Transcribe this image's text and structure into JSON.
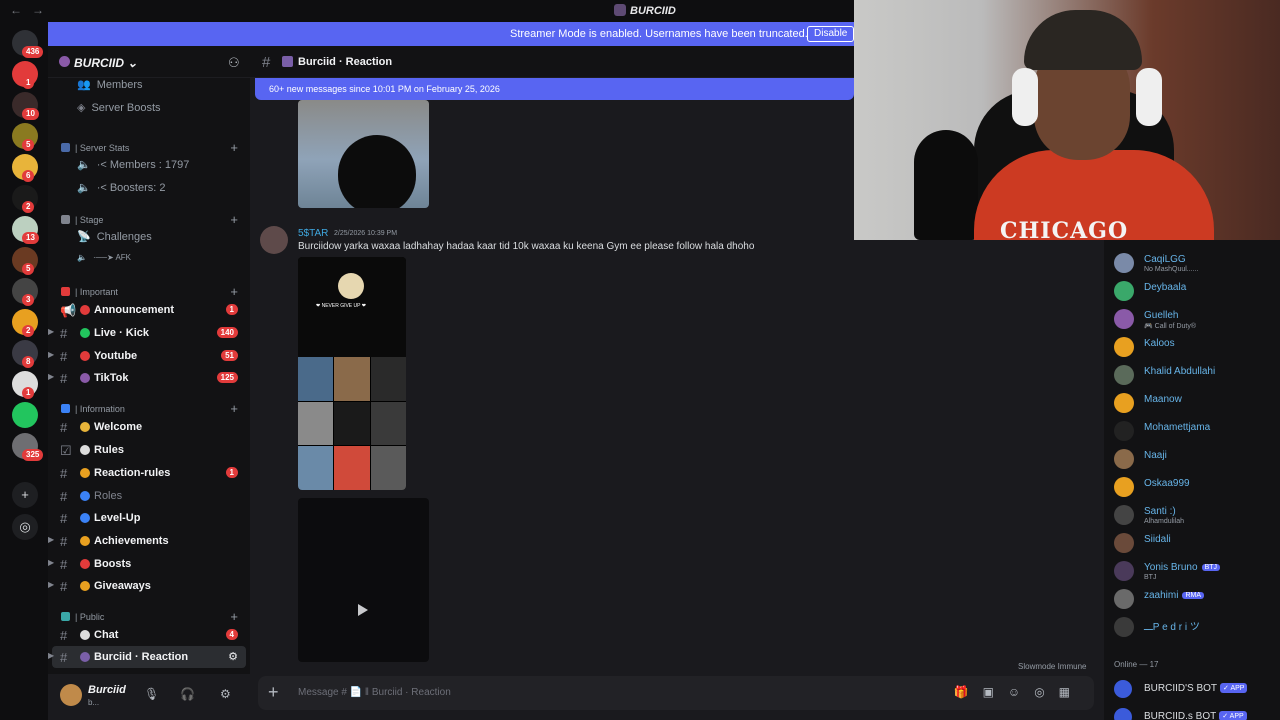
{
  "window": {
    "nav_glyphs": "←→",
    "title": "BURCIID"
  },
  "streamer_banner": {
    "text": "Streamer Mode is enabled. Usernames have been truncated.",
    "button": "Disable"
  },
  "guilds": [
    {
      "badge": "436",
      "color": "#2f3136"
    },
    {
      "badge": "1",
      "color": "#e23b3b"
    },
    {
      "badge": "10",
      "color": "#3a2a2a"
    },
    {
      "badge": "5",
      "color": "#8a7a20"
    },
    {
      "badge": "6",
      "color": "#e8b43a"
    },
    {
      "badge": "2",
      "color": "#1a1a1a"
    },
    {
      "badge": "13",
      "color": "#bcd0c0"
    },
    {
      "badge": "5",
      "color": "#6a3a22"
    },
    {
      "badge": "3",
      "color": "#444444"
    },
    {
      "badge": "2",
      "color": "#e8a020"
    },
    {
      "badge": "8",
      "color": "#3a3a44"
    },
    {
      "badge": "1",
      "color": "#dddddd"
    },
    {
      "badge": "",
      "color": "#22c55e"
    },
    {
      "badge": "325",
      "color": "#6e6e72"
    }
  ],
  "server": {
    "name": "BURCIID"
  },
  "sidebar": {
    "members": "Members",
    "server_boosts": "Server Boosts",
    "cat_stats": "| Server Stats",
    "stat_members": "·< Members : 1797",
    "stat_boosters": "·< Boosters: 2",
    "cat_stage": "| Stage",
    "challenges": "Challenges",
    "afk": "·──➤ AFK",
    "cat_important": "| Important",
    "announcement": "Announcement",
    "announcement_count": "1",
    "live": "Live · Kick",
    "live_count": "140",
    "youtube": "Youtube",
    "youtube_count": "51",
    "tiktok": "TikTok",
    "tiktok_count": "125",
    "cat_information": "| Information",
    "welcome": "Welcome",
    "rules": "Rules",
    "reaction_rules": "Reaction-rules",
    "reaction_rules_count": "1",
    "roles": "Roles",
    "level_up": "Level-Up",
    "achievements": "Achievements",
    "boosts": "Boosts",
    "giveaways": "Giveaways",
    "cat_public": "| Public",
    "chat": "Chat",
    "chat_count": "4",
    "burciid_reaction": "Burciid · Reaction"
  },
  "user": {
    "name": "Burciid",
    "status": "b..."
  },
  "channel": {
    "name": "Burciid · Reaction"
  },
  "new_messages": "60+ new messages since 10:01 PM on February 25, 2026",
  "message": {
    "author": "5$TAR",
    "time": "2/25/2026 10:39 PM",
    "text": "Burciidow yarka waxaa ladhahay hadaa kaar tid 10k waxaa ku keena Gym ee please follow hala dhoho"
  },
  "slowmode": "Slowmode Immune",
  "composer": {
    "placeholder": "Message # 📄 ‖ Burciid · Reaction"
  },
  "members_list": [
    {
      "name": "CaqiLGG",
      "sub": "No MashQuul......",
      "color": "#7a8aa8"
    },
    {
      "name": "Deybaala",
      "sub": "",
      "color": "#3aa86a"
    },
    {
      "name": "Guelleh",
      "sub": "🎮 Call of Duty®",
      "color": "#8a5aa8"
    },
    {
      "name": "Kaloos",
      "sub": "",
      "color": "#e8a020"
    },
    {
      "name": "Khalid Abdullahi",
      "sub": "",
      "color": "#5a6a5a"
    },
    {
      "name": "Maanow",
      "sub": "",
      "color": "#e8a020"
    },
    {
      "name": "Mohamettjama",
      "sub": "",
      "color": "#222222"
    },
    {
      "name": "Naaji",
      "sub": "",
      "color": "#8a6a4a"
    },
    {
      "name": "Oskaa999",
      "sub": "",
      "color": "#e8a020"
    },
    {
      "name": "Santi :)",
      "sub": "Alhamdulilah",
      "color": "#444444"
    },
    {
      "name": "Siidali",
      "sub": "",
      "color": "#6a4a3a"
    },
    {
      "name": "Yonis Bruno",
      "sub": "BTJ",
      "color": "#4a3a5a",
      "tag": "BTJ"
    },
    {
      "name": "zaahimi",
      "sub": "",
      "color": "#6a6a6a",
      "tag": "RMA"
    },
    {
      "name": "ـــP e d r i ツ",
      "sub": "",
      "color": "#3a3a3a"
    }
  ],
  "online_header": "Online — 17",
  "bots": [
    {
      "name": "BURCIID'S BOT",
      "app": "✓ APP"
    },
    {
      "name": "BURCIID.s BOT",
      "app": "✓ APP"
    }
  ],
  "webcam": {
    "shirt_text": "CHICAGO"
  }
}
